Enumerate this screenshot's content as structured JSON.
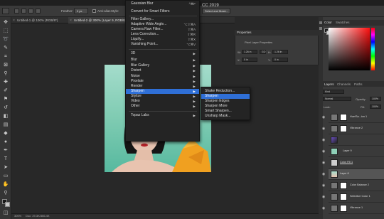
{
  "app": {
    "title": "CC 2019",
    "options": {
      "feather_label": "Feather:",
      "feather_value": "0 px",
      "anti_alias": "Anti-alias",
      "style_label": "Style:",
      "select_mask": "Select and Mask..."
    }
  },
  "tabs": [
    {
      "label": "Untitled-1 @ 100% (RGB/8*)"
    },
    {
      "label": "Untitled-2 @ 300% (Layer 9, RGB/8)"
    }
  ],
  "status": {
    "zoom": "300%",
    "doc": "Doc: 29.3K/366.4K"
  },
  "filter_menu": {
    "items": [
      {
        "label": "Gaussian Blur",
        "shortcut": "^⌘F"
      },
      {
        "label": "Convert for Smart Filters"
      },
      {
        "label": "Filter Gallery..."
      },
      {
        "label": "Adaptive Wide Angle...",
        "shortcut": "⌥⇧⌘A"
      },
      {
        "label": "Camera Raw Filter...",
        "shortcut": "⇧⌘A"
      },
      {
        "label": "Lens Correction...",
        "shortcut": "⇧⌘R"
      },
      {
        "label": "Liquify...",
        "shortcut": "⇧⌘X"
      },
      {
        "label": "Vanishing Point...",
        "shortcut": "⌥⌘V"
      },
      {
        "label": "3D",
        "arrow": "▶"
      },
      {
        "label": "Blur",
        "arrow": "▶"
      },
      {
        "label": "Blur Gallery",
        "arrow": "▶"
      },
      {
        "label": "Distort",
        "arrow": "▶"
      },
      {
        "label": "Noise",
        "arrow": "▶"
      },
      {
        "label": "Pixelate",
        "arrow": "▶"
      },
      {
        "label": "Render",
        "arrow": "▶"
      },
      {
        "label": "Sharpen",
        "arrow": "▶"
      },
      {
        "label": "Stylize",
        "arrow": "▶"
      },
      {
        "label": "Video",
        "arrow": "▶"
      },
      {
        "label": "Other",
        "arrow": "▶"
      },
      {
        "label": "Topaz Labs",
        "arrow": "▶"
      }
    ]
  },
  "sharpen_submenu": {
    "items": [
      {
        "label": "Shake Reduction..."
      },
      {
        "label": "Sharpen"
      },
      {
        "label": "Sharpen Edges"
      },
      {
        "label": "Sharpen More"
      },
      {
        "label": "Smart Sharpen..."
      },
      {
        "label": "Unsharp Mask..."
      }
    ]
  },
  "properties": {
    "title": "Properties",
    "subtitle": "Pixel Layer Properties",
    "w_label": "W:",
    "w_value": "1.26 in",
    "go_label": "GO",
    "h_label": "H:",
    "h_value": "1.26 in",
    "x_label": "X:",
    "x_value": "0 in",
    "y_label": "Y:",
    "y_value": "0 in"
  },
  "color_panel": {
    "tab1": "Color",
    "tab2": "Swatches"
  },
  "layers_panel": {
    "tabs": [
      "Layers",
      "Channels",
      "Paths"
    ],
    "kind_label": "Kind",
    "blend_mode": "Normal",
    "opacity_label": "Opacity:",
    "opacity_value": "100%",
    "lock_label": "Lock:",
    "fill_label": "Fill:",
    "fill_value": "100%",
    "layers": [
      {
        "name": "Hue/Sa...ion 1"
      },
      {
        "name": "Vibrance 2"
      },
      {
        "name": ""
      },
      {
        "name": "Layer 9"
      },
      {
        "name": "Color Fill 1"
      },
      {
        "name": "Layer 8"
      },
      {
        "name": "Color Balance 2"
      },
      {
        "name": "Selective Color 1"
      },
      {
        "name": "Vibrance 1"
      }
    ]
  },
  "colors": {
    "accent": "#2f6fd6",
    "menu_bg": "#242424",
    "panel_bg": "#3a3a3a",
    "photo_bg": "#8fd0b8"
  }
}
